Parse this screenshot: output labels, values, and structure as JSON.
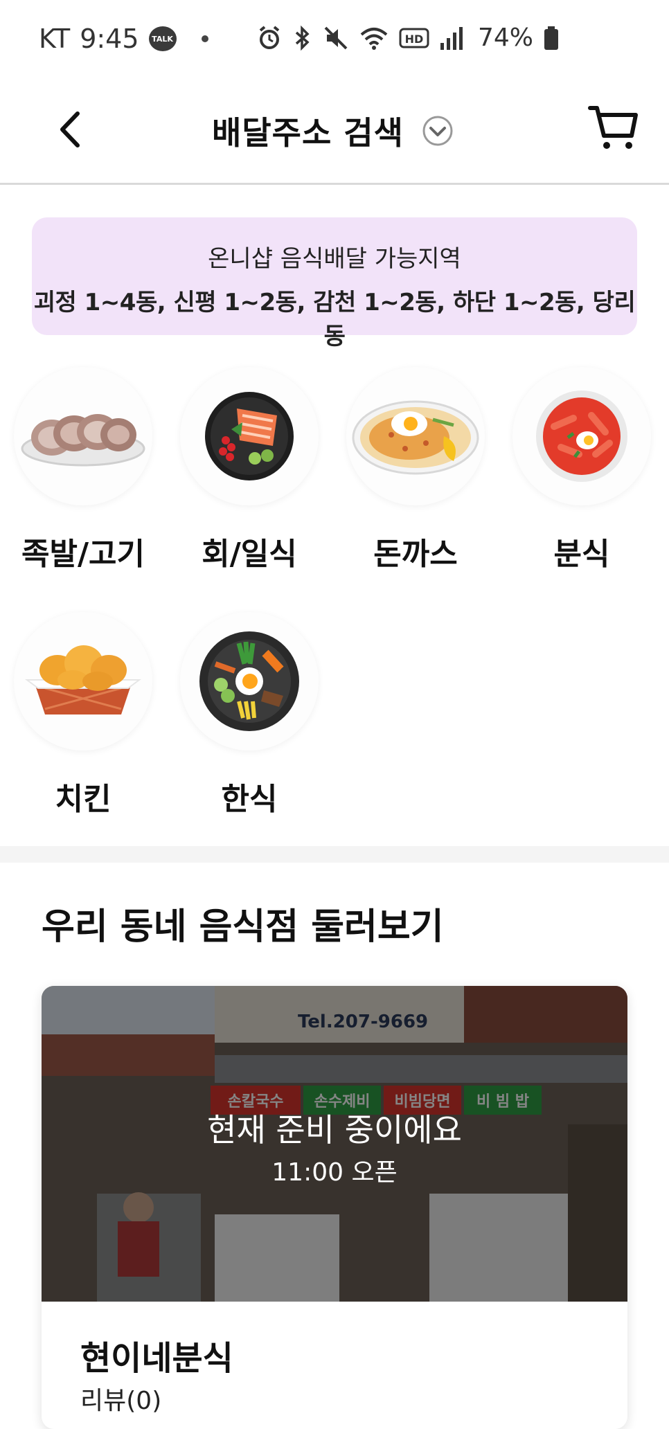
{
  "status_bar": {
    "carrier": "KT",
    "time": "9:45",
    "talk_badge": "TALK",
    "battery_percent": "74%",
    "icons": [
      "alarm-icon",
      "bluetooth-icon",
      "mute-icon",
      "wifi-icon",
      "hd-icon",
      "signal-icon",
      "battery-icon"
    ]
  },
  "header": {
    "title": "배달주소 검색",
    "icons": [
      "back-chevron-icon",
      "dropdown-chevron-icon",
      "cart-icon"
    ]
  },
  "notice": {
    "line1": "온니샵 음식배달 가능지역",
    "line2": "괴정 1~4동, 신평 1~2동, 감천 1~2동, 하단 1~2동, 당리동",
    "background": "#f2e3f9"
  },
  "categories": [
    {
      "label": "족발/고기",
      "icon": "pork-hock-icon"
    },
    {
      "label": "회/일식",
      "icon": "sashimi-icon"
    },
    {
      "label": "돈까스",
      "icon": "cutlet-icon"
    },
    {
      "label": "분식",
      "icon": "tteokbokki-icon"
    },
    {
      "label": "치킨",
      "icon": "chicken-icon"
    },
    {
      "label": "한식",
      "icon": "bibimbap-icon"
    }
  ],
  "section": {
    "title": "우리 동네 음식점 둘러보기"
  },
  "store": {
    "status": "현재 준비 중이에요",
    "open_time": "11:00 오픈",
    "name": "현이네분식",
    "review": "리뷰(0)",
    "photo_signs": {
      "phone": "Tel.207-9669",
      "menu": [
        "손칼국수",
        "손수제비",
        "비빔당면",
        "비 빔 밥"
      ]
    }
  }
}
